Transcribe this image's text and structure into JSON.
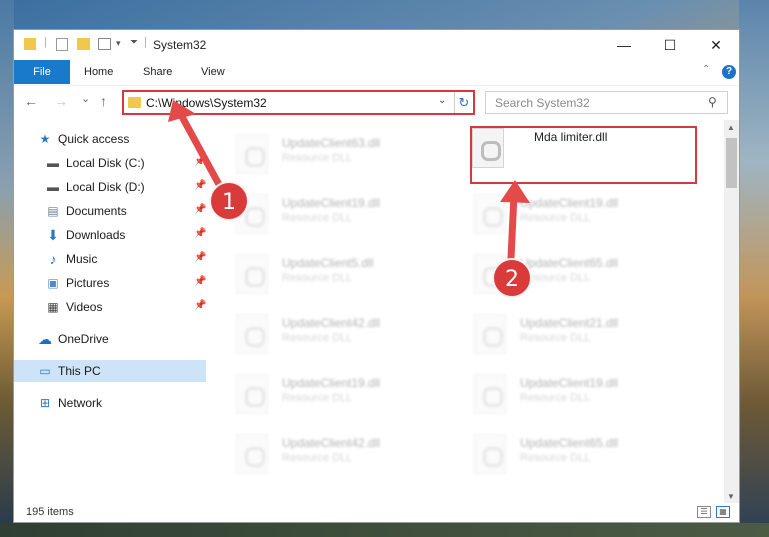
{
  "window": {
    "title": "System32",
    "controls": {
      "minimize": "—",
      "maximize": "☐",
      "close": "✕"
    }
  },
  "ribbon": {
    "tabs": [
      "File",
      "Home",
      "Share",
      "View"
    ],
    "help": "?"
  },
  "nav": {
    "back": "←",
    "forward": "→",
    "recent": "⌄",
    "up": "↑",
    "address": "C:\\Windows\\System32",
    "search_placeholder": "Search System32"
  },
  "sidebar": {
    "items": [
      {
        "label": "Quick access",
        "icon": "star-icon",
        "pinned": false
      },
      {
        "label": "Local Disk (C:)",
        "icon": "drive-icon",
        "pinned": true
      },
      {
        "label": "Local Disk (D:)",
        "icon": "drive-icon",
        "pinned": true
      },
      {
        "label": "Documents",
        "icon": "documents-icon",
        "pinned": true
      },
      {
        "label": "Downloads",
        "icon": "download-icon",
        "pinned": true
      },
      {
        "label": "Music",
        "icon": "music-icon",
        "pinned": true
      },
      {
        "label": "Pictures",
        "icon": "pictures-icon",
        "pinned": true
      },
      {
        "label": "Videos",
        "icon": "videos-icon",
        "pinned": true
      },
      {
        "label": "OneDrive",
        "icon": "cloud-icon",
        "pinned": false
      },
      {
        "label": "This PC",
        "icon": "computer-icon",
        "pinned": false,
        "selected": true
      },
      {
        "label": "Network",
        "icon": "network-icon",
        "pinned": false
      }
    ]
  },
  "files": {
    "left_column": [
      {
        "name": "UpdateClient63.dll",
        "type": "Resource DLL"
      },
      {
        "name": "UpdateClient19.dll",
        "type": "Resource DLL"
      },
      {
        "name": "UpdateClient5.dll",
        "type": "Resource DLL"
      },
      {
        "name": "UpdateClient42.dll",
        "type": "Resource DLL"
      },
      {
        "name": "UpdateClient19.dll",
        "type": "Resource DLL"
      },
      {
        "name": "UpdateClient42.dll",
        "type": "Resource DLL"
      }
    ],
    "right_column": [
      {
        "name": "Mda limiter.dll",
        "type": ""
      },
      {
        "name": "UpdateClient19.dll",
        "type": "Resource DLL"
      },
      {
        "name": "UpdateClient65.dll",
        "type": "Resource DLL"
      },
      {
        "name": "UpdateClient21.dll",
        "type": "Resource DLL"
      },
      {
        "name": "UpdateClient19.dll",
        "type": "Resource DLL"
      },
      {
        "name": "UpdateClient65.dll",
        "type": "Resource DLL"
      }
    ]
  },
  "status": {
    "item_count": "195 items"
  },
  "annotations": {
    "step1": "1",
    "step2": "2",
    "color": "#d93b3b"
  }
}
